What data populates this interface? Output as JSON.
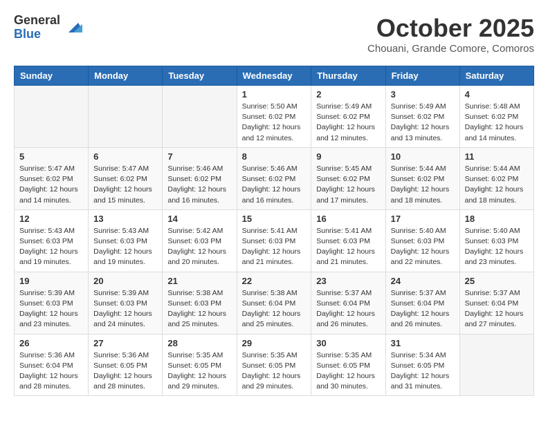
{
  "logo": {
    "general": "General",
    "blue": "Blue"
  },
  "header": {
    "month": "October 2025",
    "location": "Chouani, Grande Comore, Comoros"
  },
  "weekdays": [
    "Sunday",
    "Monday",
    "Tuesday",
    "Wednesday",
    "Thursday",
    "Friday",
    "Saturday"
  ],
  "weeks": [
    [
      {
        "day": "",
        "info": ""
      },
      {
        "day": "",
        "info": ""
      },
      {
        "day": "",
        "info": ""
      },
      {
        "day": "1",
        "info": "Sunrise: 5:50 AM\nSunset: 6:02 PM\nDaylight: 12 hours\nand 12 minutes."
      },
      {
        "day": "2",
        "info": "Sunrise: 5:49 AM\nSunset: 6:02 PM\nDaylight: 12 hours\nand 12 minutes."
      },
      {
        "day": "3",
        "info": "Sunrise: 5:49 AM\nSunset: 6:02 PM\nDaylight: 12 hours\nand 13 minutes."
      },
      {
        "day": "4",
        "info": "Sunrise: 5:48 AM\nSunset: 6:02 PM\nDaylight: 12 hours\nand 14 minutes."
      }
    ],
    [
      {
        "day": "5",
        "info": "Sunrise: 5:47 AM\nSunset: 6:02 PM\nDaylight: 12 hours\nand 14 minutes."
      },
      {
        "day": "6",
        "info": "Sunrise: 5:47 AM\nSunset: 6:02 PM\nDaylight: 12 hours\nand 15 minutes."
      },
      {
        "day": "7",
        "info": "Sunrise: 5:46 AM\nSunset: 6:02 PM\nDaylight: 12 hours\nand 16 minutes."
      },
      {
        "day": "8",
        "info": "Sunrise: 5:46 AM\nSunset: 6:02 PM\nDaylight: 12 hours\nand 16 minutes."
      },
      {
        "day": "9",
        "info": "Sunrise: 5:45 AM\nSunset: 6:02 PM\nDaylight: 12 hours\nand 17 minutes."
      },
      {
        "day": "10",
        "info": "Sunrise: 5:44 AM\nSunset: 6:02 PM\nDaylight: 12 hours\nand 18 minutes."
      },
      {
        "day": "11",
        "info": "Sunrise: 5:44 AM\nSunset: 6:02 PM\nDaylight: 12 hours\nand 18 minutes."
      }
    ],
    [
      {
        "day": "12",
        "info": "Sunrise: 5:43 AM\nSunset: 6:03 PM\nDaylight: 12 hours\nand 19 minutes."
      },
      {
        "day": "13",
        "info": "Sunrise: 5:43 AM\nSunset: 6:03 PM\nDaylight: 12 hours\nand 19 minutes."
      },
      {
        "day": "14",
        "info": "Sunrise: 5:42 AM\nSunset: 6:03 PM\nDaylight: 12 hours\nand 20 minutes."
      },
      {
        "day": "15",
        "info": "Sunrise: 5:41 AM\nSunset: 6:03 PM\nDaylight: 12 hours\nand 21 minutes."
      },
      {
        "day": "16",
        "info": "Sunrise: 5:41 AM\nSunset: 6:03 PM\nDaylight: 12 hours\nand 21 minutes."
      },
      {
        "day": "17",
        "info": "Sunrise: 5:40 AM\nSunset: 6:03 PM\nDaylight: 12 hours\nand 22 minutes."
      },
      {
        "day": "18",
        "info": "Sunrise: 5:40 AM\nSunset: 6:03 PM\nDaylight: 12 hours\nand 23 minutes."
      }
    ],
    [
      {
        "day": "19",
        "info": "Sunrise: 5:39 AM\nSunset: 6:03 PM\nDaylight: 12 hours\nand 23 minutes."
      },
      {
        "day": "20",
        "info": "Sunrise: 5:39 AM\nSunset: 6:03 PM\nDaylight: 12 hours\nand 24 minutes."
      },
      {
        "day": "21",
        "info": "Sunrise: 5:38 AM\nSunset: 6:03 PM\nDaylight: 12 hours\nand 25 minutes."
      },
      {
        "day": "22",
        "info": "Sunrise: 5:38 AM\nSunset: 6:04 PM\nDaylight: 12 hours\nand 25 minutes."
      },
      {
        "day": "23",
        "info": "Sunrise: 5:37 AM\nSunset: 6:04 PM\nDaylight: 12 hours\nand 26 minutes."
      },
      {
        "day": "24",
        "info": "Sunrise: 5:37 AM\nSunset: 6:04 PM\nDaylight: 12 hours\nand 26 minutes."
      },
      {
        "day": "25",
        "info": "Sunrise: 5:37 AM\nSunset: 6:04 PM\nDaylight: 12 hours\nand 27 minutes."
      }
    ],
    [
      {
        "day": "26",
        "info": "Sunrise: 5:36 AM\nSunset: 6:04 PM\nDaylight: 12 hours\nand 28 minutes."
      },
      {
        "day": "27",
        "info": "Sunrise: 5:36 AM\nSunset: 6:05 PM\nDaylight: 12 hours\nand 28 minutes."
      },
      {
        "day": "28",
        "info": "Sunrise: 5:35 AM\nSunset: 6:05 PM\nDaylight: 12 hours\nand 29 minutes."
      },
      {
        "day": "29",
        "info": "Sunrise: 5:35 AM\nSunset: 6:05 PM\nDaylight: 12 hours\nand 29 minutes."
      },
      {
        "day": "30",
        "info": "Sunrise: 5:35 AM\nSunset: 6:05 PM\nDaylight: 12 hours\nand 30 minutes."
      },
      {
        "day": "31",
        "info": "Sunrise: 5:34 AM\nSunset: 6:05 PM\nDaylight: 12 hours\nand 31 minutes."
      },
      {
        "day": "",
        "info": ""
      }
    ]
  ]
}
